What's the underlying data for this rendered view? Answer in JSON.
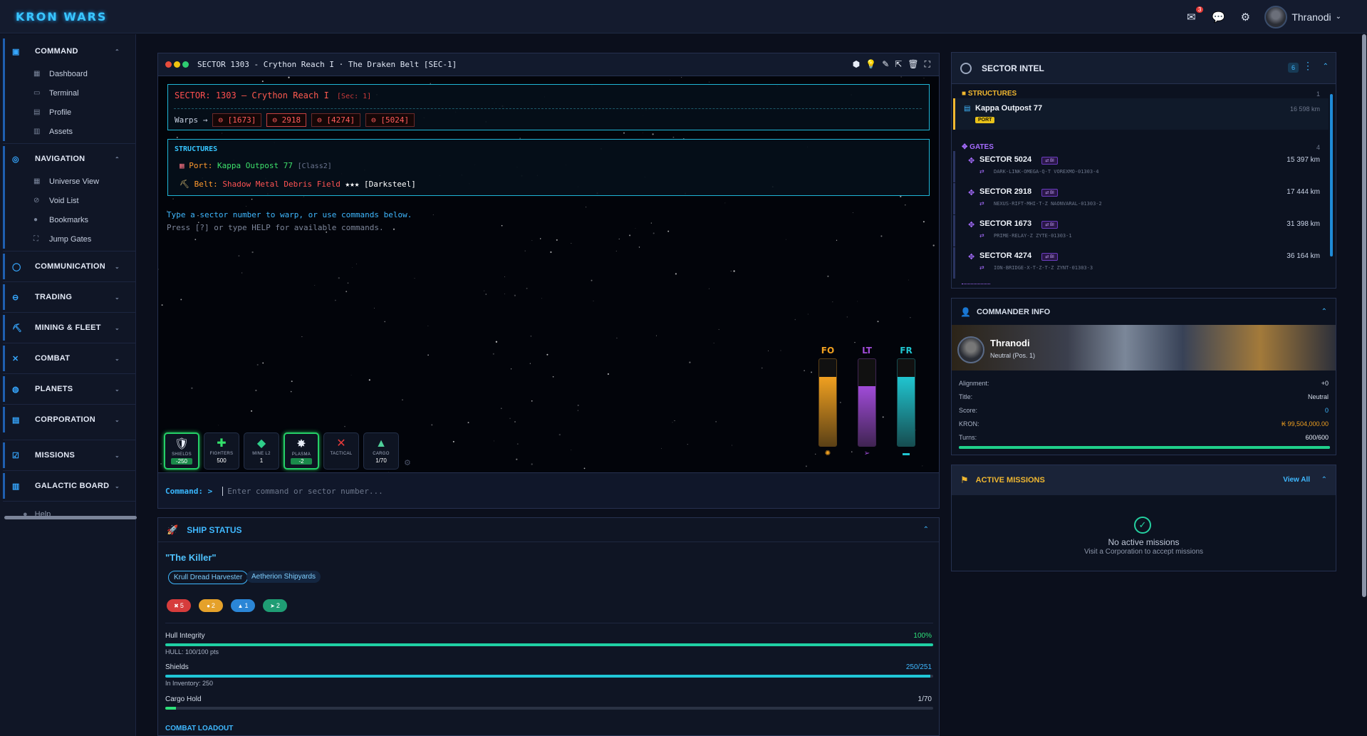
{
  "app": {
    "logo": "KRON WARS"
  },
  "topbar": {
    "mail_badge": "3",
    "username": "Thranodi",
    "user_caret": "⌄"
  },
  "sidebar": {
    "groups": [
      {
        "label": "COMMAND",
        "items": [
          "Dashboard",
          "Terminal",
          "Profile",
          "Assets"
        ]
      },
      {
        "label": "NAVIGATION",
        "items": [
          "Universe View",
          "Void List",
          "Bookmarks",
          "Jump Gates"
        ]
      },
      {
        "label": "COMMUNICATION"
      },
      {
        "label": "TRADING"
      },
      {
        "label": "MINING & FLEET"
      },
      {
        "label": "COMBAT"
      },
      {
        "label": "PLANETS"
      },
      {
        "label": "CORPORATION"
      },
      {
        "label": "MISSIONS"
      },
      {
        "label": "GALACTIC BOARD"
      }
    ],
    "help": "Help"
  },
  "terminal": {
    "title": "SECTOR 1303 - Crython Reach I · The Draken Belt [SEC-1]",
    "sector_label": "SECTOR:",
    "sector_number": "1303",
    "sector_dash": "–",
    "sector_name": "Crython Reach I",
    "sector_sec": "[Sec: 1]",
    "warps_label": "Warps →",
    "warps": [
      "[1673]",
      "2918",
      "[4274]",
      "[5024]"
    ],
    "structures_label": "STRUCTURES",
    "port_prefix": "Port:",
    "port_name": "Kappa Outpost 77",
    "port_class": "[Class2]",
    "belt_prefix": "Belt:",
    "belt_name": "Shadow Metal Debris Field",
    "belt_stars": "★★★",
    "belt_type": "[Darksteel]",
    "hint_1": "Type a sector number to warp, or use commands below.",
    "hint_2": "Press [?] or type HELP for available commands.",
    "gauges": [
      {
        "label": "FO",
        "color": "#f0a020",
        "fill": 0.78
      },
      {
        "label": "LT",
        "color": "#a04bd8",
        "fill": 0.68
      },
      {
        "label": "FR",
        "color": "#20c5d0",
        "fill": 0.78
      }
    ],
    "slots": [
      {
        "label": "SHIELDS",
        "value": "-250",
        "icon": "shield-icon",
        "glyph": "🛡",
        "on": true
      },
      {
        "label": "FIGHTERS",
        "value": "500",
        "icon": "fighters-icon",
        "glyph": "✚",
        "on": false
      },
      {
        "label": "MINE L2",
        "value": "1",
        "icon": "mine-icon",
        "glyph": "◆",
        "on": false
      },
      {
        "label": "PLASMA",
        "value": "-2",
        "icon": "plasma-icon",
        "glyph": "✸",
        "on": true
      },
      {
        "label": "TACTICAL",
        "value": "",
        "icon": "tactical-x-icon",
        "glyph": "✕",
        "on": false
      },
      {
        "label": "CARGO",
        "value": "1/70",
        "icon": "cargo-icon",
        "glyph": "▲",
        "on": false
      }
    ],
    "command_label": "Command: >",
    "command_placeholder": "Enter command or sector number..."
  },
  "ship": {
    "title": "SHIP STATUS",
    "name": "\"The Killer\"",
    "class_pill": "Krull Dread Harvester",
    "maker_pill": "Aetherion Shipyards",
    "chips": [
      {
        "value": "5",
        "color": "#d63c3c",
        "icon": "weapons-icon",
        "glyph": "✖"
      },
      {
        "value": "2",
        "color": "#e5a12a",
        "icon": "torpedo-icon",
        "glyph": "●"
      },
      {
        "value": "1",
        "color": "#2b86d6",
        "icon": "shield-chip-icon",
        "glyph": "▲"
      },
      {
        "value": "2",
        "color": "#1f9d74",
        "icon": "engine-icon",
        "glyph": "➤"
      }
    ],
    "hull_label": "Hull Integrity",
    "hull_value": "100%",
    "hull_fill": 1.0,
    "hull_sub": "HULL: 100/100 pts",
    "shields_label": "Shields",
    "shields_value": "250/251",
    "shields_fill": 0.996,
    "shields_sub": "In Inventory: 250",
    "cargo_label": "Cargo Hold",
    "cargo_value": "1/70",
    "cargo_fill": 0.014,
    "loadout_label": "COMBAT LOADOUT"
  },
  "intel": {
    "title": "SECTOR INTEL",
    "count": "6",
    "structures_label": "STRUCTURES",
    "structures_count": "1",
    "port_name": "Kappa Outpost 77",
    "port_tag": "PORT",
    "port_dist": "16 598 km",
    "gates_label": "GATES",
    "gates_count": "4",
    "gates": [
      {
        "name": "SECTOR 5024",
        "tag": "⇄ BI",
        "dist": "15 397 km",
        "sub": "DARK-LINK-OMEGA-Q-T VOREXMO-01303-4"
      },
      {
        "name": "SECTOR 2918",
        "tag": "⇄ BI",
        "dist": "17 444 km",
        "sub": "NEXUS-RIFT-MHI-T-Z NAONVARAL-01303-2"
      },
      {
        "name": "SECTOR 1673",
        "tag": "⇄ BI",
        "dist": "31 398 km",
        "sub": "PRIME-RELAY-Z ZYTE-01303-1"
      },
      {
        "name": "SECTOR 4274",
        "tag": "⇄ BI",
        "dist": "36 164 km",
        "sub": "ION-BRIDGE-X-T-Z-T-Z ZYNT-01303-3"
      }
    ]
  },
  "commander": {
    "title": "COMMANDER INFO",
    "name": "Thranodi",
    "alignment_text": "Neutral (Pos. 1)",
    "rows": [
      {
        "label": "Alignment:",
        "value": "+0",
        "color": "#d6deeb"
      },
      {
        "label": "Title:",
        "value": "Neutral",
        "color": "#d6deeb"
      },
      {
        "label": "Score:",
        "value": "0",
        "color": "#3fb8ff"
      },
      {
        "label": "KRON:",
        "value": "₭ 99,504,000.00",
        "color": "#f0a020"
      },
      {
        "label": "Turns:",
        "value": "600/600",
        "color": "#e7edf8"
      }
    ],
    "turns_fill": 1.0
  },
  "missions": {
    "title": "ACTIVE MISSIONS",
    "view_all": "View All",
    "empty": "No active missions",
    "hint": "Visit a Corporation to accept missions"
  }
}
